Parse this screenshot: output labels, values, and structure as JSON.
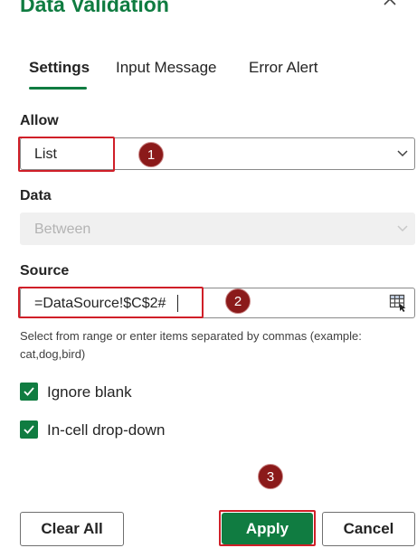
{
  "dialog": {
    "title": "Data Validation"
  },
  "tabs": [
    {
      "label": "Settings",
      "active": true
    },
    {
      "label": "Input Message",
      "active": false
    },
    {
      "label": "Error Alert",
      "active": false
    }
  ],
  "allow": {
    "label": "Allow",
    "value": "List"
  },
  "data": {
    "label": "Data",
    "value": "Between",
    "disabled": true
  },
  "source": {
    "label": "Source",
    "value": "=DataSource!$C$2#",
    "hint": "Select from range or enter items separated by commas (example: cat,dog,bird)"
  },
  "options": {
    "ignore_blank": {
      "label": "Ignore blank",
      "checked": true
    },
    "in_cell_dropdown": {
      "label": "In-cell drop-down",
      "checked": true
    }
  },
  "buttons": {
    "clear_all": "Clear All",
    "apply": "Apply",
    "cancel": "Cancel"
  },
  "annotations": {
    "marker_1": "1",
    "marker_2": "2",
    "marker_3": "3"
  },
  "colors": {
    "accent": "#107c41",
    "highlight": "#d01f28",
    "marker": "#8b1a1a"
  }
}
